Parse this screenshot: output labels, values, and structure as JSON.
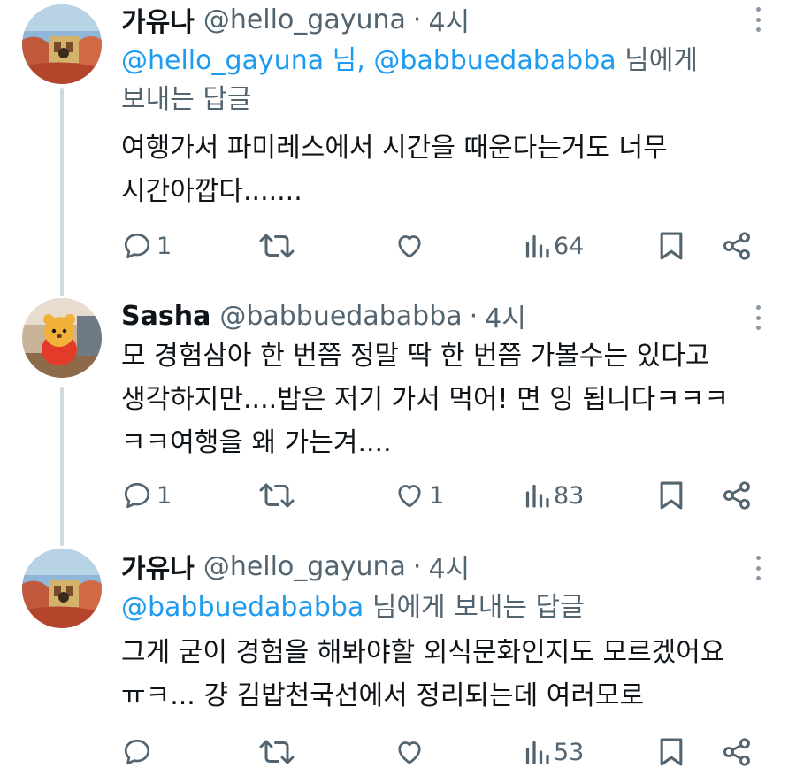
{
  "tweets": [
    {
      "name": "가유나",
      "handle": "@hello_gayuna",
      "separator": "·",
      "time": "4시",
      "reply_mentions": [
        "@hello_gayuna 님,",
        "@babbuedababba"
      ],
      "reply_suffix": "님에게",
      "reply_suffix2": "보내는 답글",
      "text_lines": [
        "여행가서 파미레스에서 시간을 때운다는거도 너무",
        "시간아깝다......."
      ],
      "replies": "1",
      "retweets": "",
      "likes": "",
      "views": "64"
    },
    {
      "name": "Sasha",
      "handle": "@babbuedababba",
      "separator": "·",
      "time": "4시",
      "text_lines": [
        "모 경험삼아 한 번쯤 정말 딱 한 번쯤 가볼수는 있다고",
        "생각하지만....밥은 저기 가서 먹어! 면 잉 됩니다ㅋㅋㅋ",
        "ㅋㅋ여행을 왜 가는겨...."
      ],
      "replies": "1",
      "retweets": "",
      "likes": "1",
      "views": "83"
    },
    {
      "name": "가유나",
      "handle": "@hello_gayuna",
      "separator": "·",
      "time": "4시",
      "reply_mention": "@babbuedababba",
      "reply_suffix": "님에게 보내는 답글",
      "text_lines": [
        "그게 굳이 경험을 해봐야할 외식문화인지도 모르겠어요",
        "ㅠㅋ... 걍 김밥천국선에서 정리되는데 여러모로"
      ],
      "replies": "",
      "retweets": "",
      "likes": "",
      "views": "53"
    }
  ],
  "icons": {
    "reply": "reply-icon",
    "retweet": "retweet-icon",
    "like": "heart-icon",
    "views": "views-icon",
    "bookmark": "bookmark-icon",
    "share": "share-icon",
    "more": "more-icon"
  },
  "colors": {
    "text": "#0f1419",
    "secondary": "#536471",
    "mention": "#1d9bf0",
    "thread_line": "#cfd9de"
  }
}
